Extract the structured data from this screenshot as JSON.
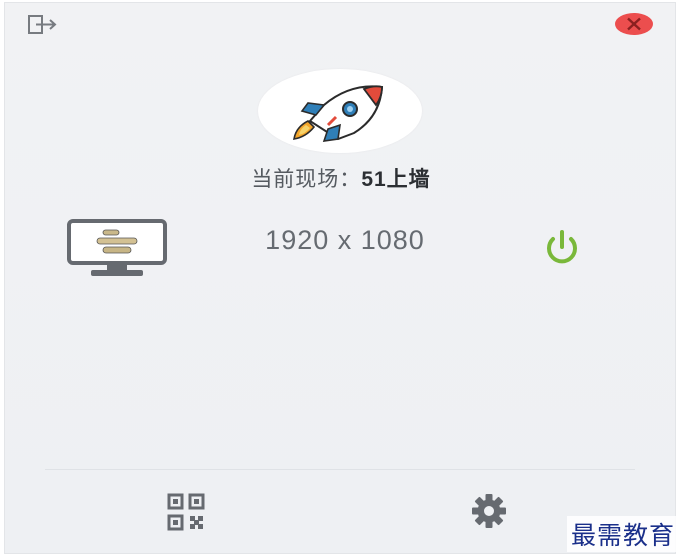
{
  "venue": {
    "label": "当前现场：",
    "value": "51上墙"
  },
  "display": {
    "resolution": "1920 x 1080"
  },
  "icons": {
    "exit": "exit-icon",
    "close": "close-icon",
    "logo": "rocket-icon",
    "monitor": "monitor-icon",
    "power": "power-icon",
    "qr": "qr-code-icon",
    "settings": "gear-icon"
  },
  "colors": {
    "close": "#ec4e4e",
    "power": "#7ab83a",
    "icon_gray": "#666a70",
    "watermark": "#1a2f8a"
  },
  "watermark": {
    "text": "最需教育"
  }
}
